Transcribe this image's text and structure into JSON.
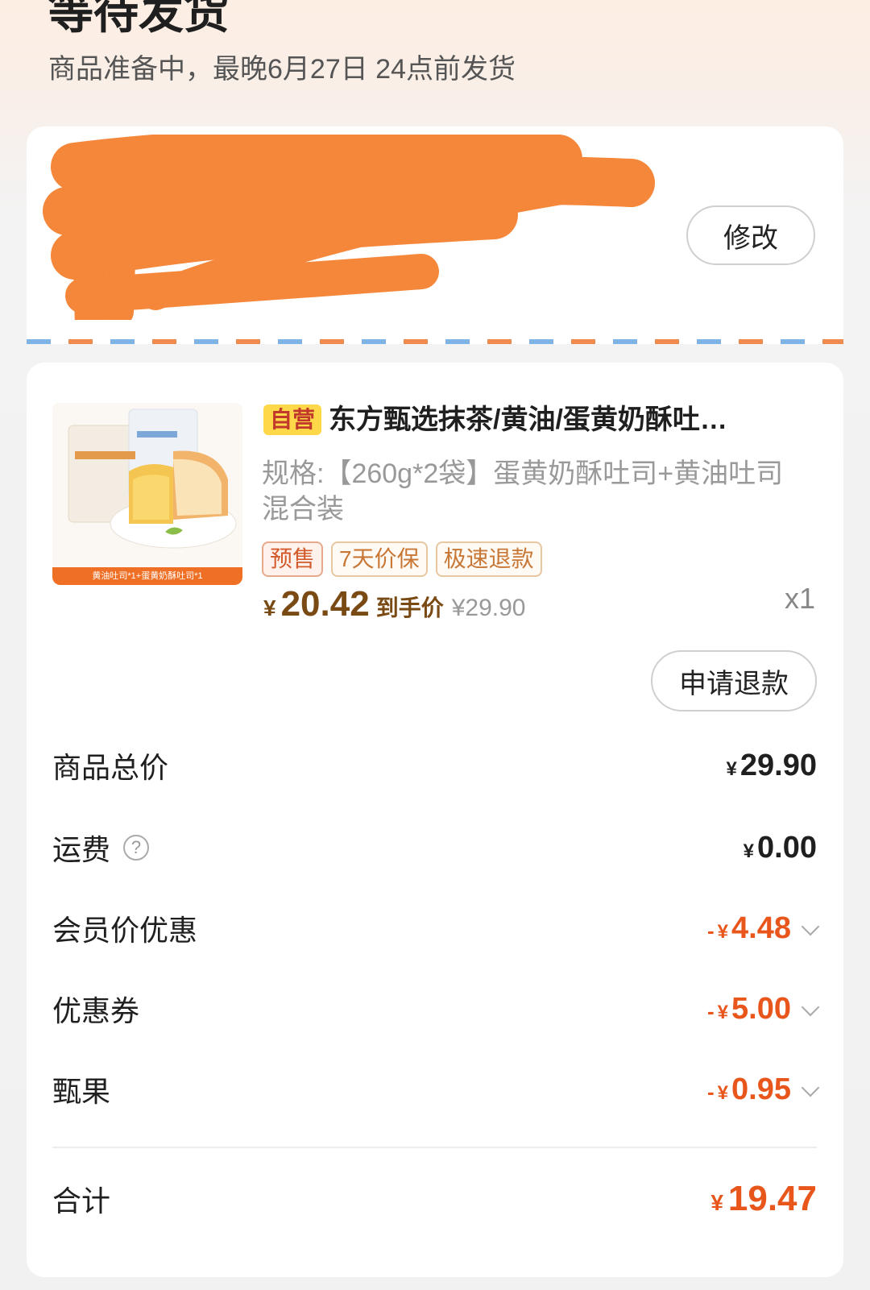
{
  "header": {
    "status_title": "等待发货",
    "status_subtitle": "商品准备中，最晚6月27日 24点前发货"
  },
  "address": {
    "edit_label": "修改"
  },
  "product": {
    "self_badge": "自营",
    "title": "东方甄选抹茶/黄油/蛋黄奶酥吐…",
    "spec": "规格:【260g*2袋】蛋黄奶酥吐司+黄油吐司混合装",
    "image_caption": "黄油吐司*1+蛋黄奶酥吐司*1",
    "tags": [
      "预售",
      "7天价保",
      "极速退款"
    ],
    "price_symbol": "¥",
    "price": "20.42",
    "price_note": "到手价",
    "original_price": "¥29.90",
    "quantity": "x1",
    "refund_label": "申请退款"
  },
  "summary": {
    "goods_total_label": "商品总价",
    "goods_total": "29.90",
    "shipping_label": "运费",
    "shipping": "0.00",
    "member_discount_label": "会员价优惠",
    "member_discount": "4.48",
    "coupon_label": "优惠券",
    "coupon": "5.00",
    "zhenguo_label": "甄果",
    "zhenguo": "0.95",
    "total_label": "合计",
    "total": "19.47",
    "currency": "¥",
    "minus": "-"
  },
  "colors": {
    "accent": "#e8561c",
    "price_brown": "#7a4a14",
    "redaction": "#f5873a"
  }
}
